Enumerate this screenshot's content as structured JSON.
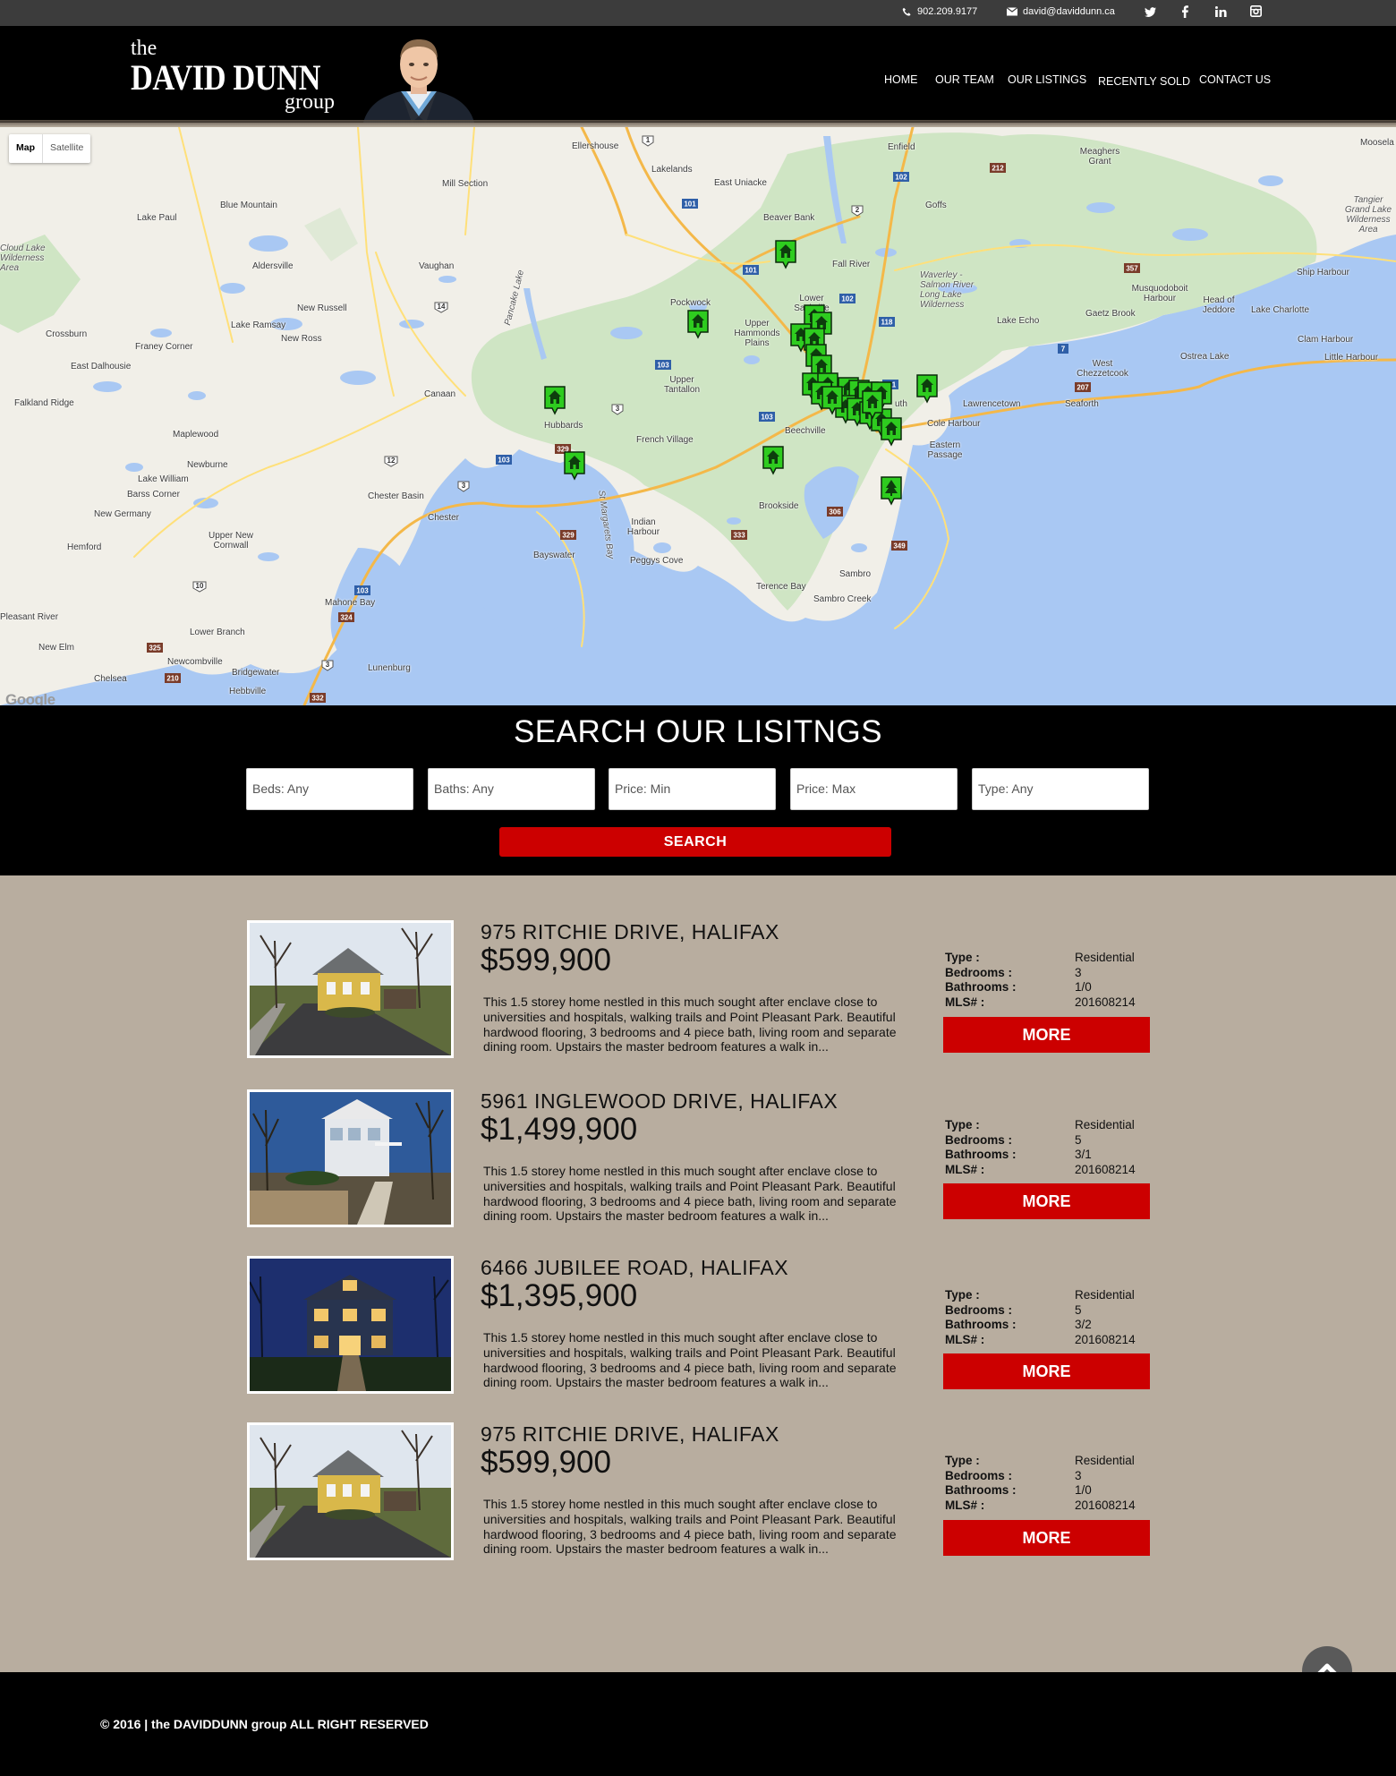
{
  "topbar": {
    "phone": "902.209.9177",
    "email": "david@daviddunn.ca",
    "social_icons": [
      "twitter-icon",
      "facebook-icon",
      "linkedin-icon",
      "instagram-icon"
    ]
  },
  "brand": {
    "the": "the",
    "name": "DAVID DUNN",
    "group": "group"
  },
  "nav": [
    "HOME",
    "OUR TEAM",
    "OUR LISTINGS",
    "RECENTLY SOLD",
    "CONTACT US"
  ],
  "map": {
    "toggle": [
      "Map",
      "Satellite"
    ],
    "attribution": "Google",
    "places": [
      "Ellershouse",
      "Enfield",
      "Mill Section",
      "Lakelands",
      "East Uniacke",
      "Meaghers Grant",
      "Moosela",
      "Blue Mountain",
      "Goffs",
      "Lake Paul",
      "Beaver Bank",
      "Tangier Grand Lake Wilderness Area",
      "Cloud Lake Wilderness Area",
      "Aldersville",
      "Vaughan",
      "Fall River",
      "Ship Harbour",
      "Waverley - Salmon River Long Lake Wilderness",
      "Musquodoboit Harbour",
      "Head of Jeddore",
      "New Russell",
      "Pockwock",
      "Lower Sackville",
      "Lake Charlotte",
      "Lake Ramsay",
      "Gaetz Brook",
      "Crossburn",
      "New Ross",
      "Upper Hammonds Plains",
      "Lake Echo",
      "Clam Harbour",
      "Franey Corner",
      "Pancake Lake",
      "Ostrea Lake",
      "Little Harbour",
      "East Dalhousie",
      "Upper Tantallon",
      "West Chezzetcook",
      "Canaan",
      "Falkland Ridge",
      "Lawrencetown",
      "Seaforth",
      "Hubbards",
      "French Village",
      "Beechville",
      "Cole Harbour",
      "Maplewood",
      "Eastern Passage",
      "Newburne",
      "Lake William",
      "Barss Corner",
      "Chester Basin",
      "St Margarets Bay",
      "Brookside",
      "New Germany",
      "Chester",
      "Indian Harbour",
      "Upper New Cornwall",
      "Hemford",
      "Bayswater",
      "Peggys Cove",
      "Sambro",
      "Terence Bay",
      "Sambro Creek",
      "Mahone Bay",
      "Pleasant River",
      "Lower Branch",
      "New Elm",
      "Newcombville",
      "Chelsea",
      "Bridgewater",
      "Lunenburg",
      "Hebbville",
      "uth"
    ],
    "highway_shields": [
      "102",
      "212",
      "101",
      "2",
      "1",
      "357",
      "7",
      "118",
      "107",
      "103",
      "3",
      "111",
      "207",
      "329",
      "333",
      "306",
      "349",
      "12",
      "14",
      "10",
      "324",
      "325",
      "210",
      "332"
    ]
  },
  "search": {
    "title": "SEARCH OUR LISITNGS",
    "fields": [
      "Beds: Any",
      "Baths: Any",
      "Price: Min",
      "Price: Max",
      "Type: Any"
    ],
    "button": "SEARCH"
  },
  "spec_labels": {
    "type": "Type :",
    "bedrooms": "Bedrooms :",
    "bathrooms": "Bathrooms :",
    "mls": "MLS# :"
  },
  "listings": [
    {
      "address": "975 RITCHIE DRIVE, HALIFAX",
      "price": "$599,900",
      "description": "This 1.5 storey home nestled in this much sought after enclave close to universities and hospitals, walking trails and Point Pleasant Park. Beautiful hardwood flooring, 3 bedrooms and 4 piece bath, living room and separate dining room. Upstairs the master bedroom features a walk in...",
      "type": "Residential",
      "bedrooms": "3",
      "bathrooms": "1/0",
      "mls": "201608214",
      "more": "MORE"
    },
    {
      "address": "5961 INGLEWOOD DRIVE, HALIFAX",
      "price": "$1,499,900",
      "description": "This 1.5 storey home nestled in this much sought after enclave close to universities and hospitals, walking trails and Point Pleasant Park. Beautiful hardwood flooring, 3 bedrooms and 4 piece bath, living room and separate dining room. Upstairs the master bedroom features a walk in...",
      "type": "Residential",
      "bedrooms": "5",
      "bathrooms": "3/1",
      "mls": "201608214",
      "more": "MORE"
    },
    {
      "address": "6466 JUBILEE ROAD, HALIFAX",
      "price": "$1,395,900",
      "description": "This 1.5 storey home nestled in this much sought after enclave close to universities and hospitals, walking trails and Point Pleasant Park. Beautiful hardwood flooring, 3 bedrooms and 4 piece bath, living room and separate dining room. Upstairs the master bedroom features a walk in...",
      "type": "Residential",
      "bedrooms": "5",
      "bathrooms": "3/2",
      "mls": "201608214",
      "more": "MORE"
    },
    {
      "address": "975 RITCHIE DRIVE, HALIFAX",
      "price": "$599,900",
      "description": "This 1.5 storey home nestled in this much sought after enclave close to universities and hospitals, walking trails and Point Pleasant Park. Beautiful hardwood flooring, 3 bedrooms and 4 piece bath, living room and separate dining room. Upstairs the master bedroom features a walk in...",
      "type": "Residential",
      "bedrooms": "3",
      "bathrooms": "1/0",
      "mls": "201608214",
      "more": "MORE"
    }
  ],
  "footer": {
    "copyright": "© 2016 | the DAVIDDUNN group ALL RIGHT RESERVED"
  },
  "colors": {
    "accent_red": "#cc0000",
    "header_black": "#000000",
    "listing_background": "#b8ad9f",
    "marker_green": "#2ecc1f"
  }
}
